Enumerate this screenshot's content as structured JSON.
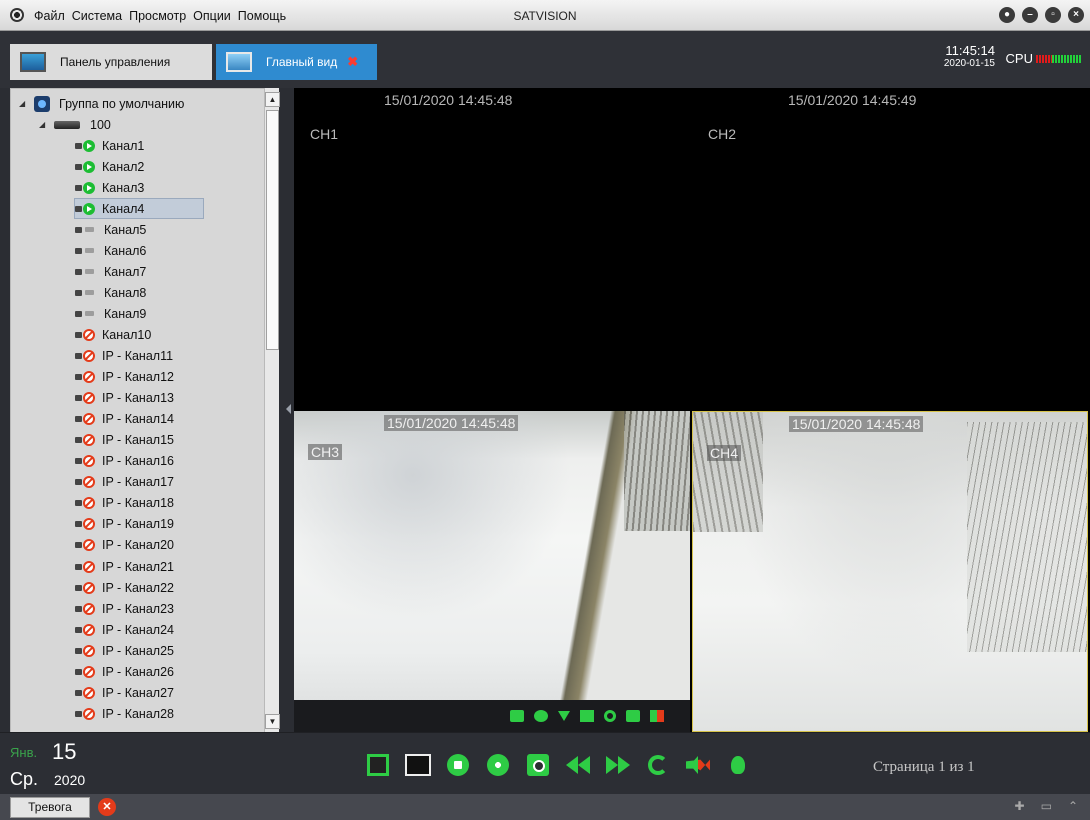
{
  "menu": {
    "items": [
      "Файл",
      "Система",
      "Просмотр",
      "Опции",
      "Помощь"
    ]
  },
  "app_title": "SATVISION",
  "window_buttons": [
    "lock-icon",
    "minimize-icon",
    "maximize-icon",
    "close-icon"
  ],
  "tabs": [
    {
      "label": "Панель управления",
      "icon": "control-panel-icon"
    },
    {
      "label": "Главный вид",
      "icon": "monitor-icon",
      "active": true
    }
  ],
  "clock": {
    "time": "11:45:14",
    "date": "2020-01-15"
  },
  "cpu": {
    "label": "CPU"
  },
  "tree": {
    "group": "Группа по умолчанию",
    "device": "100",
    "channels": [
      {
        "label": "Канал1",
        "status": "online"
      },
      {
        "label": "Канал2",
        "status": "online"
      },
      {
        "label": "Канал3",
        "status": "online"
      },
      {
        "label": "Канал4",
        "status": "online",
        "selected": true
      },
      {
        "label": "Канал5",
        "status": "idle"
      },
      {
        "label": "Канал6",
        "status": "idle"
      },
      {
        "label": "Канал7",
        "status": "idle"
      },
      {
        "label": "Канал8",
        "status": "idle"
      },
      {
        "label": "Канал9",
        "status": "idle"
      },
      {
        "label": "Канал10",
        "status": "offline"
      },
      {
        "label": "IP - Канал11",
        "status": "offline"
      },
      {
        "label": "IP - Канал12",
        "status": "offline"
      },
      {
        "label": "IP - Канал13",
        "status": "offline"
      },
      {
        "label": "IP - Канал14",
        "status": "offline"
      },
      {
        "label": "IP - Канал15",
        "status": "offline"
      },
      {
        "label": "IP - Канал16",
        "status": "offline"
      },
      {
        "label": "IP - Канал17",
        "status": "offline"
      },
      {
        "label": "IP - Канал18",
        "status": "offline"
      },
      {
        "label": "IP - Канал19",
        "status": "offline"
      },
      {
        "label": "IP - Канал20",
        "status": "offline"
      },
      {
        "label": "IP - Канал21",
        "status": "offline"
      },
      {
        "label": "IP - Канал22",
        "status": "offline"
      },
      {
        "label": "IP - Канал23",
        "status": "offline"
      },
      {
        "label": "IP - Канал24",
        "status": "offline"
      },
      {
        "label": "IP - Канал25",
        "status": "offline"
      },
      {
        "label": "IP - Канал26",
        "status": "offline"
      },
      {
        "label": "IP - Канал27",
        "status": "offline"
      },
      {
        "label": "IP - Канал28",
        "status": "offline"
      }
    ]
  },
  "tiles": [
    {
      "channel": "CH1",
      "timestamp": "15/01/2020 14:45:48"
    },
    {
      "channel": "CH2",
      "timestamp": "15/01/2020 14:45:49"
    },
    {
      "channel": "CH3",
      "timestamp": "15/01/2020 14:45:48"
    },
    {
      "channel": "CH4",
      "timestamp": "15/01/2020 14:45:48"
    }
  ],
  "tile_toolbar_icons": [
    "snapshot-icon",
    "record-icon",
    "download-icon",
    "stop-icon",
    "zoom-icon",
    "camera-settings-icon",
    "mute-icon"
  ],
  "date": {
    "month": "Янв.",
    "day": "15",
    "weekday": "Ср.",
    "year": "2020"
  },
  "controls": [
    "fullscreen-icon",
    "single-view-icon",
    "stop-all-icon",
    "record-all-icon",
    "snapshot-all-icon",
    "rewind-icon",
    "fast-forward-icon",
    "cycle-icon",
    "mute-icon",
    "light-icon"
  ],
  "page_info": "Страница 1 из 1",
  "statusbar": {
    "alarm_label": "Тревога"
  },
  "colors": {
    "accent": "#2ecc45",
    "tab_active": "#2f8bd0",
    "error": "#e43b1a"
  }
}
